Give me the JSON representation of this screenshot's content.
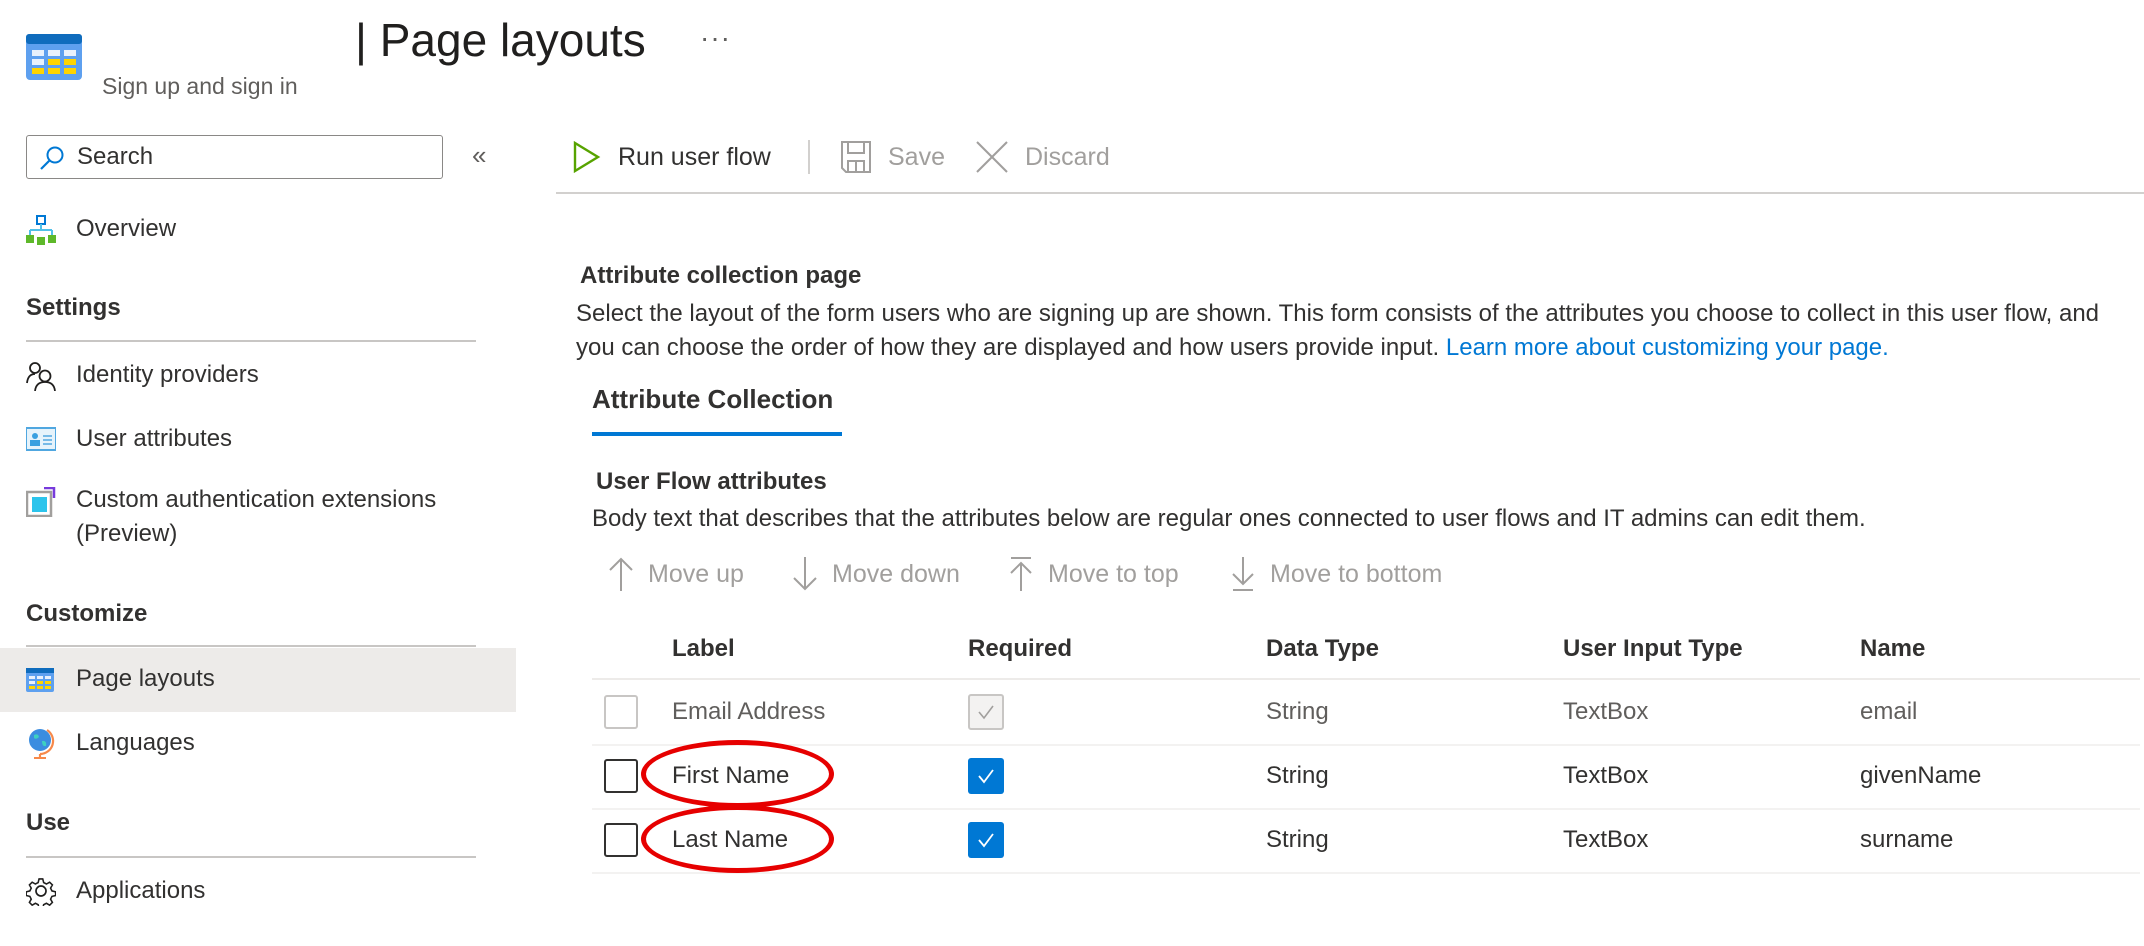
{
  "header": {
    "title": "| Page layouts",
    "more": "···",
    "subtitle": "Sign up and sign in",
    "app_icon": "page-layouts-icon"
  },
  "sidebar": {
    "search_placeholder": "Search",
    "collapse": "«",
    "overview": {
      "label": "Overview",
      "icon": "overview-hierarchy-icon"
    },
    "sections": [
      {
        "heading": "Settings",
        "items": [
          {
            "label": "Identity providers",
            "icon": "people-icon"
          },
          {
            "label": "User attributes",
            "icon": "contact-card-icon"
          },
          {
            "label": "Custom authentication extensions",
            "label2": "(Preview)",
            "icon": "extension-icon"
          }
        ]
      },
      {
        "heading": "Customize",
        "items": [
          {
            "label": "Page layouts",
            "icon": "page-layouts-icon",
            "selected": true
          },
          {
            "label": "Languages",
            "icon": "globe-icon"
          }
        ]
      },
      {
        "heading": "Use",
        "items": [
          {
            "label": "Applications",
            "icon": "gear-icon"
          }
        ]
      }
    ]
  },
  "toolbar": {
    "run_label": "Run user flow",
    "save_label": "Save",
    "discard_label": "Discard"
  },
  "main": {
    "section_title": "Attribute collection page",
    "section_desc": "Select the layout of the form users who are signing up are shown. This form consists of the attributes you choose to collect in this user flow, and you can choose the order of how they are displayed and how users provide input.",
    "learn_more": "Learn more about customizing your page.",
    "tab_label": "Attribute Collection",
    "subsection_title": "User Flow attributes",
    "subsection_desc": "Body text that describes that the attributes below are regular ones connected to user flows and IT admins can edit them.",
    "move_actions": {
      "up": "Move up",
      "down": "Move down",
      "top": "Move to top",
      "bottom": "Move to bottom"
    },
    "table": {
      "columns": [
        "Label",
        "Required",
        "Data Type",
        "User Input Type",
        "Name"
      ],
      "rows": [
        {
          "label": "Email Address",
          "required": true,
          "required_disabled": true,
          "data_type": "String",
          "input_type": "TextBox",
          "name": "email",
          "disabled": true,
          "highlighted": false
        },
        {
          "label": "First Name",
          "required": true,
          "required_disabled": false,
          "data_type": "String",
          "input_type": "TextBox",
          "name": "givenName",
          "disabled": false,
          "highlighted": true
        },
        {
          "label": "Last Name",
          "required": true,
          "required_disabled": false,
          "data_type": "String",
          "input_type": "TextBox",
          "name": "surname",
          "disabled": false,
          "highlighted": true
        }
      ]
    }
  },
  "colors": {
    "accent": "#0078d4",
    "run_icon": "#57a300",
    "highlight_annotation": "#e60000",
    "selected_bg": "#edebe9"
  }
}
